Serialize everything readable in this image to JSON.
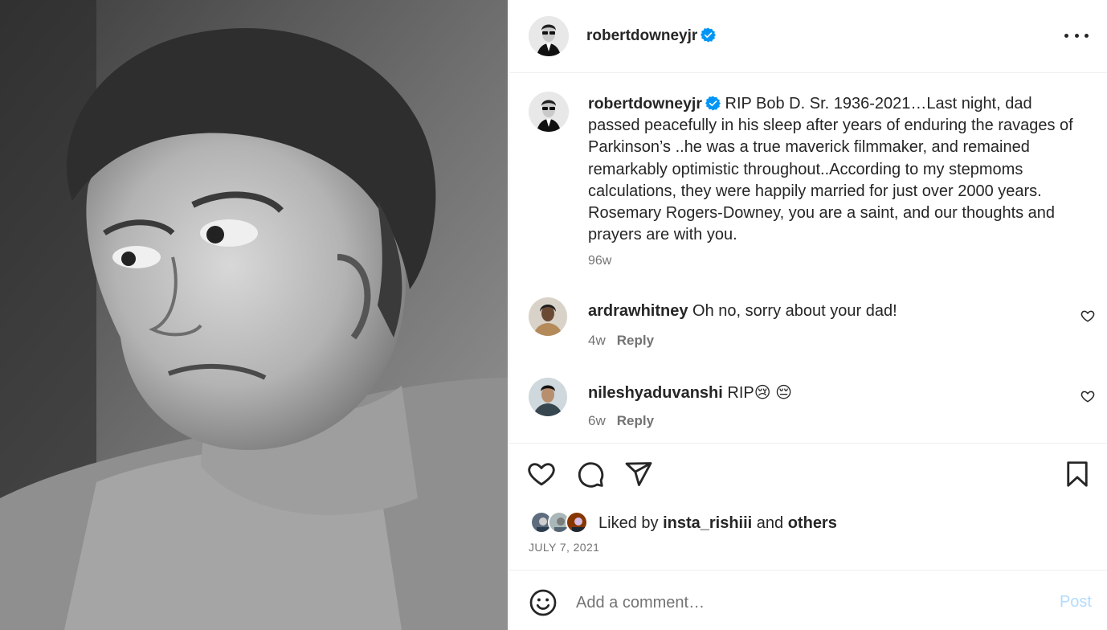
{
  "photo": {
    "subject": "black-and-white portrait",
    "icon": "photo"
  },
  "header": {
    "username": "robertdowneyjr",
    "verified": true,
    "more_icon": "more-horizontal-icon"
  },
  "caption": {
    "username": "robertdowneyjr",
    "text": "RIP Bob D. Sr. 1936-2021…Last night, dad passed peacefully in his sleep after years of enduring the ravages of Parkinson’s ..he was a true maverick filmmaker, and remained remarkably optimistic throughout..According to my stepmoms calculations, they were happily married for just over 2000 years. Rosemary Rogers-Downey, you are a saint, and our thoughts and prayers are with you.",
    "time": "96w"
  },
  "comments": [
    {
      "username": "ardrawhitney",
      "text": "Oh no, sorry about your dad!",
      "time": "4w",
      "reply_label": "Reply"
    },
    {
      "username": "nileshyaduvanshi",
      "text": "RIP😢 😔",
      "time": "6w",
      "reply_label": "Reply"
    }
  ],
  "likes": {
    "prefix": "Liked by",
    "user": "insta_rishiii",
    "connector": "and",
    "others": "others"
  },
  "date": "JULY 7, 2021",
  "add_comment": {
    "placeholder": "Add a comment…",
    "post_label": "Post"
  },
  "colors": {
    "text": "#262626",
    "secondary": "#737373",
    "verified": "#0095f6",
    "post_disabled": "#b3dbff",
    "border": "#efefef"
  }
}
